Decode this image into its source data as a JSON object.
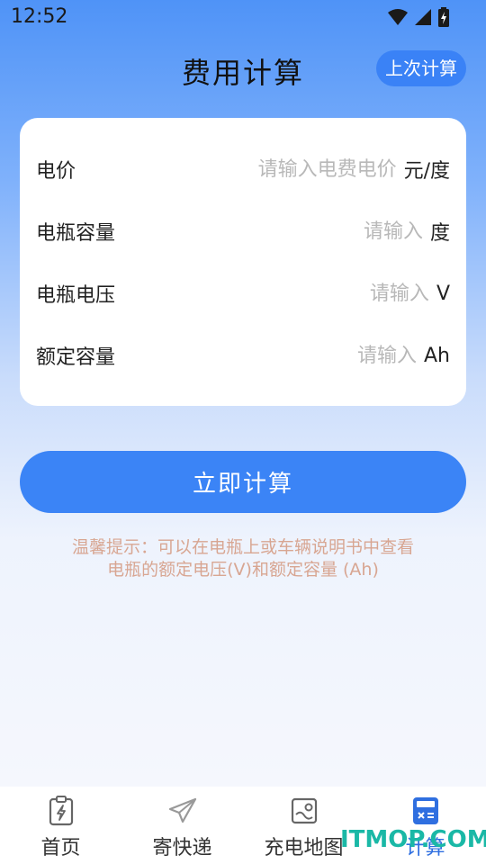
{
  "status_bar": {
    "time": "12:52"
  },
  "header": {
    "title": "费用计算",
    "history_button": "上次计算"
  },
  "form": {
    "rows": [
      {
        "label": "电价",
        "placeholder": "请输入电费电价",
        "unit": "元/度"
      },
      {
        "label": "电瓶容量",
        "placeholder": "请输入",
        "unit": "度"
      },
      {
        "label": "电瓶电压",
        "placeholder": "请输入",
        "unit": "V"
      },
      {
        "label": "额定容量",
        "placeholder": "请输入",
        "unit": "Ah"
      }
    ]
  },
  "calculate_button": "立即计算",
  "tip": {
    "line1": "温馨提示：可以在电瓶上或车辆说明书中查看",
    "line2": "电瓶的额定电压(V)和额定容量 (Ah)"
  },
  "tab_bar": {
    "items": [
      {
        "label": "首页",
        "icon": "clipboard-bolt-icon"
      },
      {
        "label": "寄快递",
        "icon": "paper-plane-icon"
      },
      {
        "label": "充电地图",
        "icon": "map-icon"
      },
      {
        "label": "计算",
        "icon": "calculator-icon",
        "active": true
      }
    ]
  },
  "watermark": "ITMOP.COM",
  "colors": {
    "accent": "#3b84f6",
    "tip": "#d8a692",
    "watermark": "#1ab8a6"
  }
}
